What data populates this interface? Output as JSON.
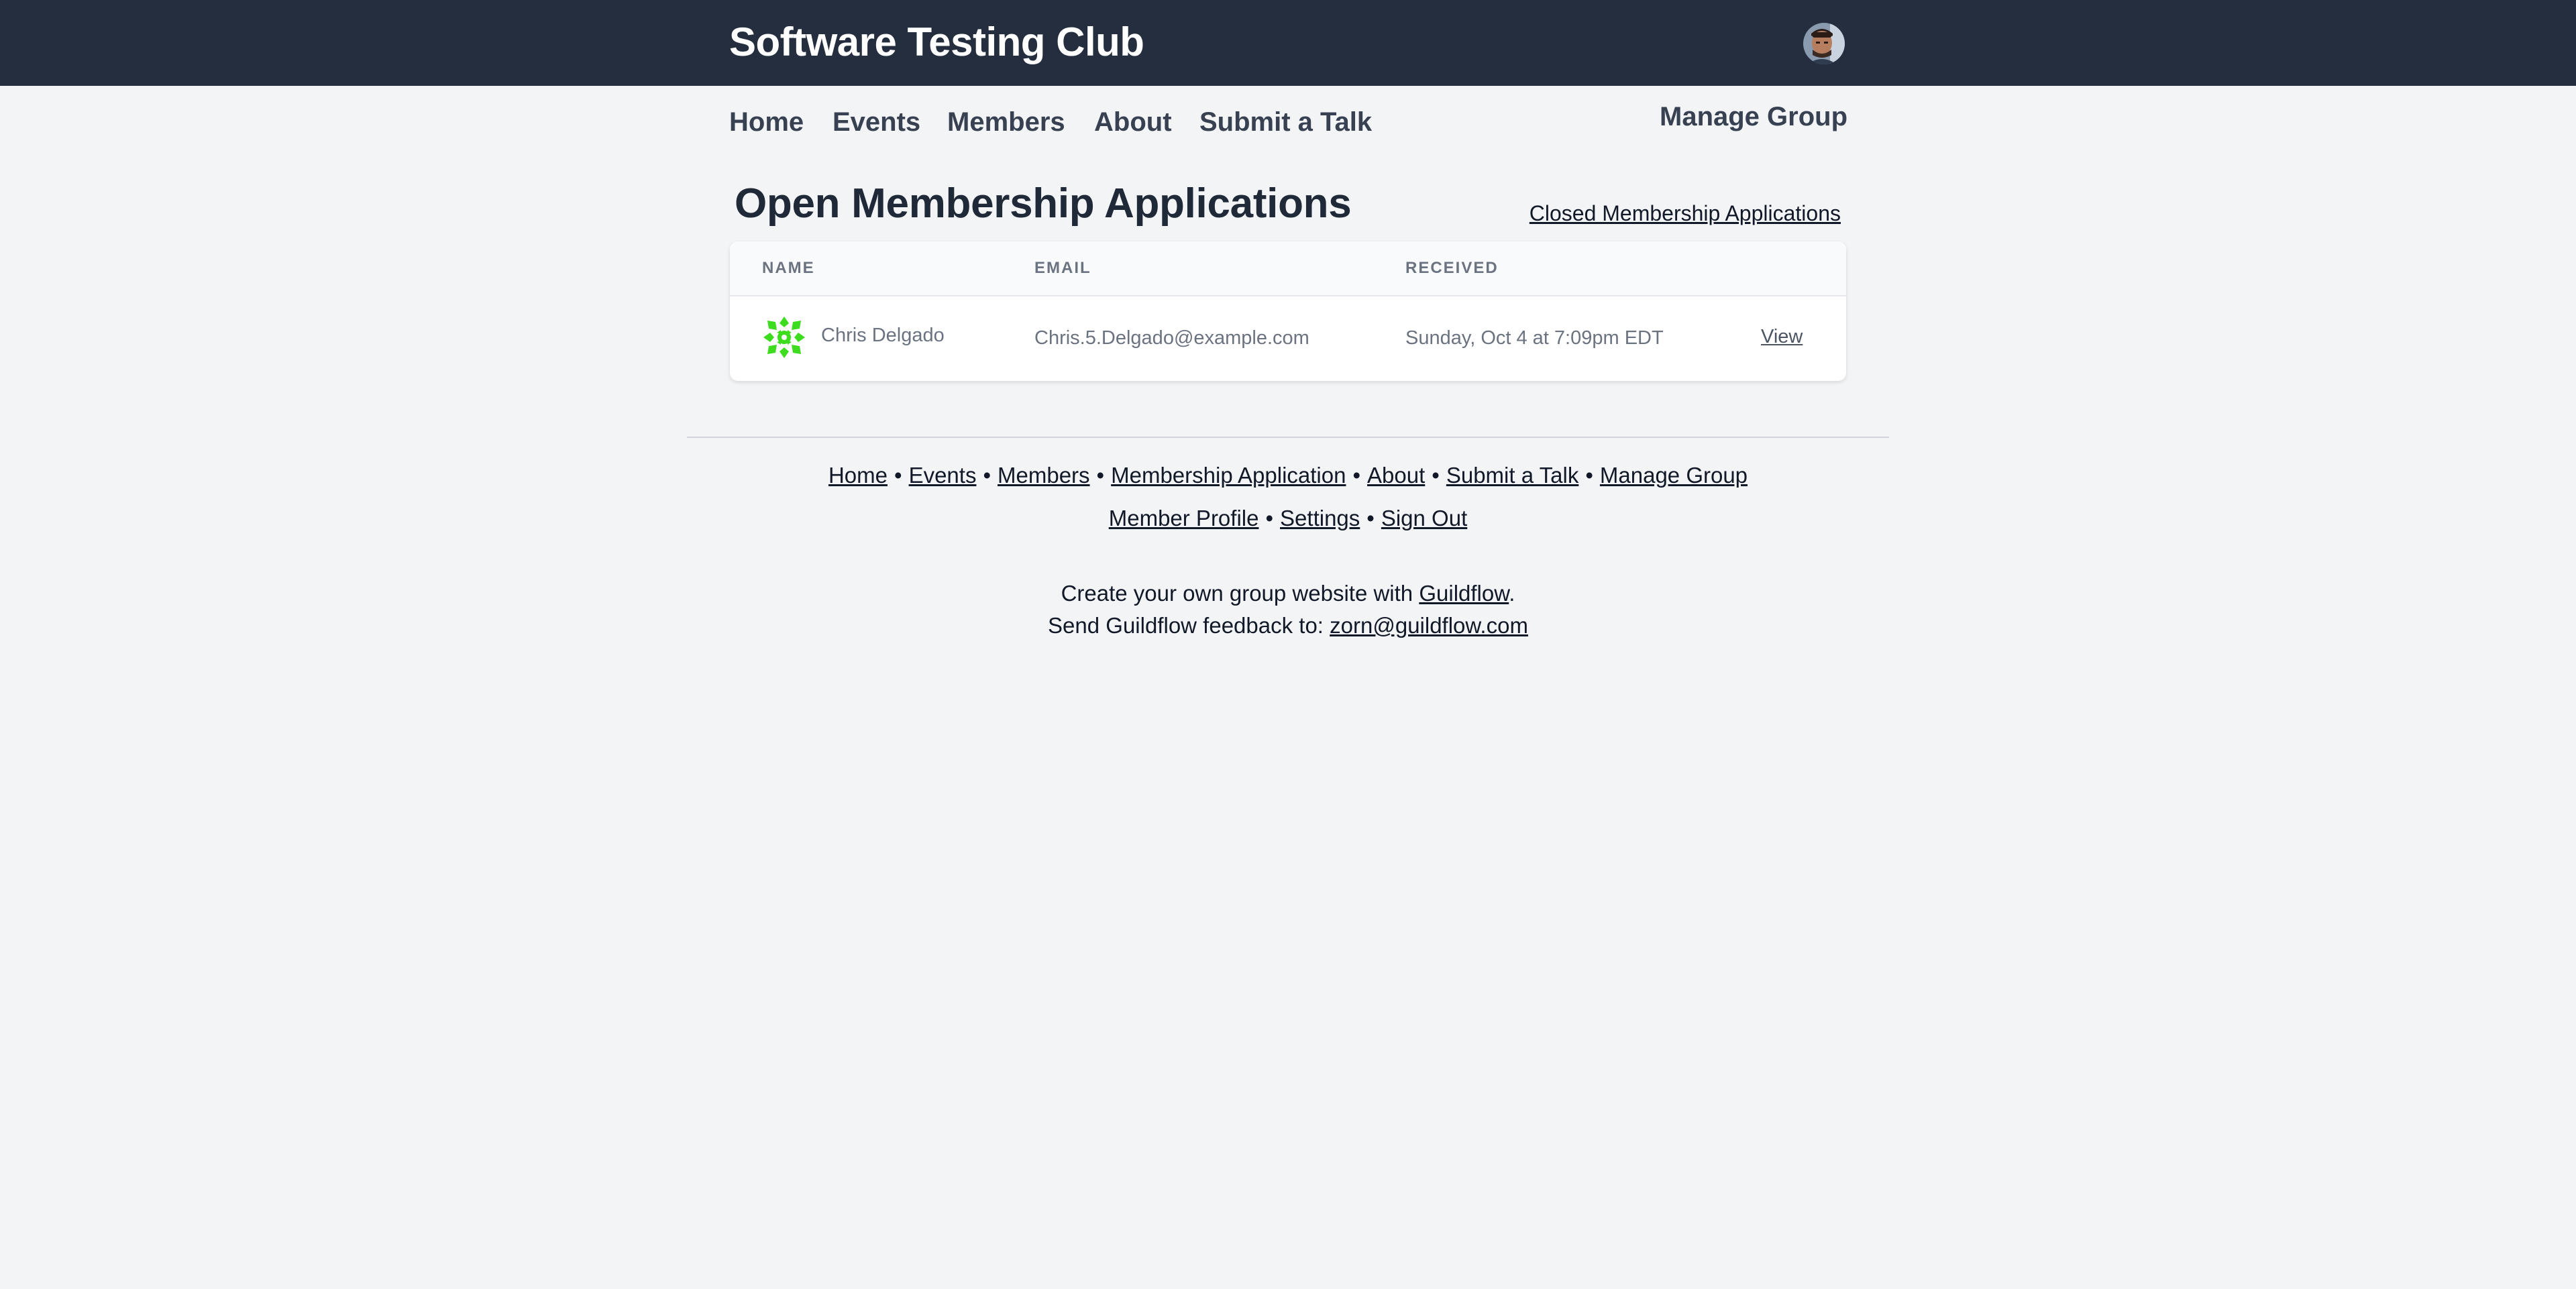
{
  "header": {
    "site_title": "Software Testing Club",
    "avatar_icon": "user-avatar"
  },
  "nav": {
    "items": [
      {
        "label": "Home"
      },
      {
        "label": "Events"
      },
      {
        "label": "Members"
      },
      {
        "label": "About"
      },
      {
        "label": "Submit a Talk"
      }
    ],
    "manage_group": "Manage Group"
  },
  "main": {
    "title": "Open Membership Applications",
    "closed_link": "Closed Membership Applications",
    "table": {
      "columns": [
        "Name",
        "Email",
        "Received",
        ""
      ],
      "rows": [
        {
          "name": "Chris Delgado",
          "email": "Chris.5.Delgado@example.com",
          "received": "Sunday, Oct 4 at 7:09pm EDT",
          "action": "View",
          "avatar_icon": "identicon-green"
        }
      ]
    }
  },
  "footer": {
    "links_row1": [
      "Home",
      "Events",
      "Members",
      "Membership Application",
      "About",
      "Submit a Talk",
      "Manage Group"
    ],
    "links_row2": [
      "Member Profile",
      "Settings",
      "Sign Out"
    ],
    "separator": "•",
    "credit_prefix": "Create your own group website with ",
    "credit_link": "Guildflow",
    "credit_suffix": ".",
    "feedback_prefix": "Send Guildflow feedback to: ",
    "feedback_email": "zorn@guildflow.com"
  },
  "colors": {
    "topbar": "#252e3e",
    "background": "#f3f4f6",
    "identicon": "#3ddc1f"
  }
}
